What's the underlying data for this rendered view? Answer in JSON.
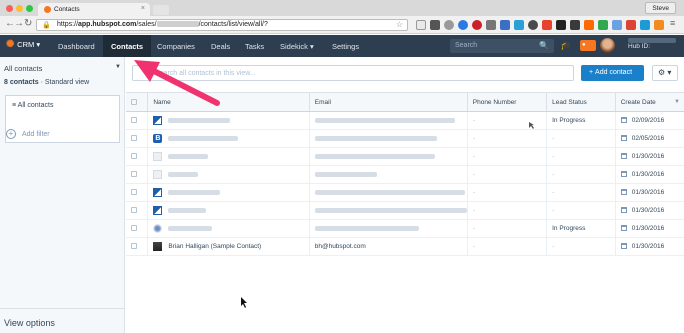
{
  "browser": {
    "tab_title": "Contacts",
    "tab_close": "×",
    "profile_name": "Steve",
    "url_prefix": "https://",
    "url_host": "app.hubspot.com",
    "url_path_start": "/sales/",
    "url_path_end": "/contacts/list/view/all/?"
  },
  "nav": {
    "logo": "CRM ▾",
    "items": [
      "Dashboard",
      "Contacts",
      "Companies",
      "Deals",
      "Tasks",
      "Sidekick ▾",
      "Settings"
    ],
    "active": "Contacts",
    "search_placeholder": "Search",
    "search_icon": "🔍",
    "hub_id_label": "Hub ID:"
  },
  "sidebar": {
    "view_name": "All contacts",
    "count": "8 contacts",
    "view_type": " · Standard view",
    "filter_header": "All contacts",
    "add_filter": "Add filter",
    "view_options": "View options"
  },
  "main": {
    "search_placeholder": "Search all contacts in this view...",
    "add_button": "Add contact",
    "gear_icon": "⚙ ▾"
  },
  "table": {
    "columns": [
      "Name",
      "Email",
      "Phone Number",
      "Lead Status",
      "Create Date"
    ],
    "rows": [
      {
        "logo": "v",
        "name": "",
        "email": "",
        "phone": "-",
        "status": "In Progress",
        "date": "02/09/2016"
      },
      {
        "logo": "b",
        "name": "",
        "email": "",
        "phone": "-",
        "status": "-",
        "date": "02/05/2016"
      },
      {
        "logo": "ph",
        "name": "",
        "email": "",
        "phone": "-",
        "status": "-",
        "date": "01/30/2016"
      },
      {
        "logo": "ph",
        "name": "",
        "email": "",
        "phone": "-",
        "status": "-",
        "date": "01/30/2016"
      },
      {
        "logo": "v",
        "name": "",
        "email": "",
        "phone": "-",
        "status": "-",
        "date": "01/30/2016"
      },
      {
        "logo": "v",
        "name": "",
        "email": "",
        "phone": "-",
        "status": "-",
        "date": "01/30/2016"
      },
      {
        "logo": "sw",
        "name": "",
        "email": "",
        "phone": "-",
        "status": "In Progress",
        "date": "01/30/2016"
      },
      {
        "logo": "pp",
        "name": "Brian Halligan (Sample Contact)",
        "email": "bh@hubspot.com",
        "phone": "-",
        "status": "-",
        "date": "01/30/2016"
      }
    ]
  },
  "colors": {
    "nav_bg": "#2d3e50",
    "accent_orange": "#f57722",
    "button_blue": "#1980c9",
    "arrow_pink": "#f0326e"
  }
}
